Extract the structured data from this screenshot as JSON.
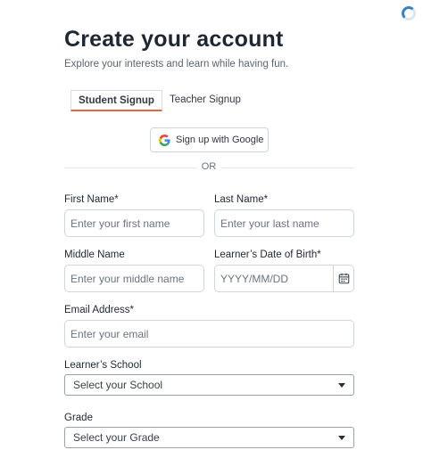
{
  "header": {
    "title": "Create your account",
    "subtitle": "Explore your interests and learn while having fun."
  },
  "tabs": [
    {
      "label": "Student Signup",
      "active": true
    },
    {
      "label": "Teacher Signup",
      "active": false
    }
  ],
  "google_button": {
    "label": "Sign up with Google",
    "icon": "google-icon"
  },
  "divider": {
    "text": "OR"
  },
  "form": {
    "first_name": {
      "label": "First Name*",
      "placeholder": "Enter your first name",
      "value": ""
    },
    "last_name": {
      "label": "Last Name*",
      "placeholder": "Enter your last name",
      "value": ""
    },
    "middle_name": {
      "label": "Middle Name",
      "placeholder": "Enter your middle name",
      "value": ""
    },
    "dob": {
      "label": "Learner’s Date of Birth*",
      "placeholder": "YYYY/MM/DD",
      "value": "",
      "icon": "calendar-icon"
    },
    "email": {
      "label": "Email Address*",
      "placeholder": "Enter your email",
      "value": ""
    },
    "school": {
      "label": "Learner’s School",
      "selected": "Select your School"
    },
    "grade": {
      "label": "Grade",
      "selected": "Select your Grade"
    }
  },
  "colors": {
    "tab_accent": "#e6683c",
    "spinner": "#3b82c4"
  }
}
